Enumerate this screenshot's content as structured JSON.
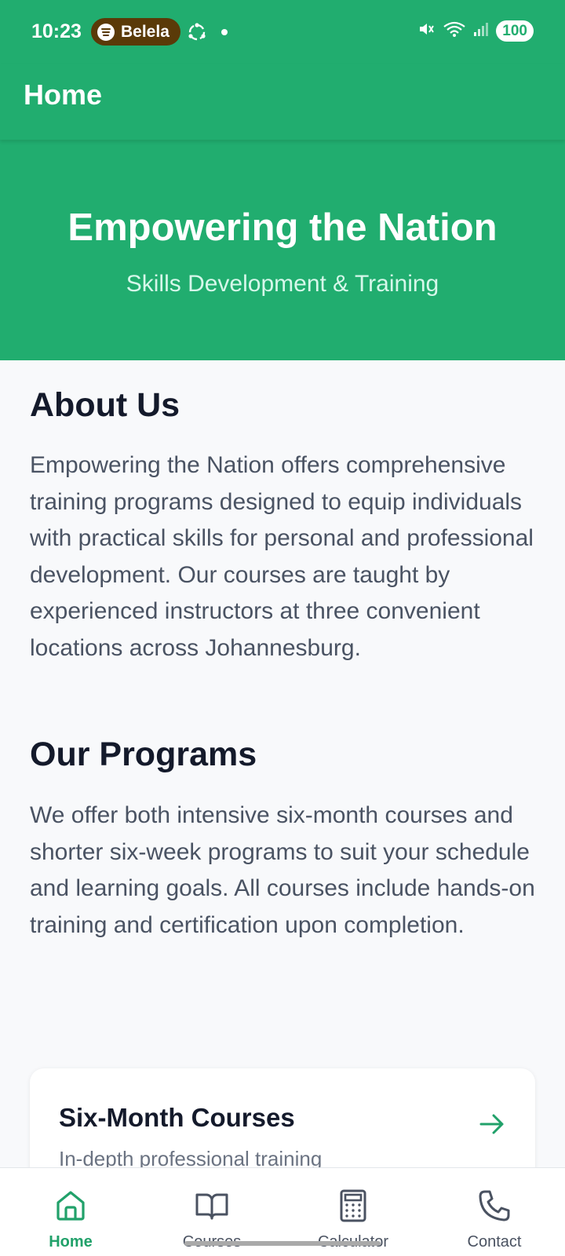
{
  "status_bar": {
    "time": "10:23",
    "spotify_label": "Belela",
    "battery": "100",
    "icons": [
      "spotify-icon",
      "sync-icon",
      "notification-dot-icon",
      "mute-icon",
      "wifi-icon",
      "signal-icon",
      "battery-icon"
    ]
  },
  "app_bar": {
    "title": "Home"
  },
  "hero": {
    "title": "Empowering the Nation",
    "subtitle": "Skills Development & Training"
  },
  "about": {
    "title": "About Us",
    "body": "Empowering the Nation offers comprehensive training programs designed to equip individuals with practical skills for personal and professional development. Our courses are taught by experienced instructors at three convenient locations across Johannesburg."
  },
  "programs": {
    "title": "Our Programs",
    "body": "We offer both intensive six-month courses and shorter six-week programs to suit your schedule and learning goals. All courses include hands-on training and certification upon completion."
  },
  "card": {
    "title": "Six-Month Courses",
    "subtitle": "In-depth professional training",
    "icon": "arrow-right-icon"
  },
  "bottom_nav": {
    "items": [
      {
        "label": "Home",
        "icon": "home-icon",
        "active": true
      },
      {
        "label": "Courses",
        "icon": "book-icon",
        "active": false
      },
      {
        "label": "Calculator",
        "icon": "calculator-icon",
        "active": false
      },
      {
        "label": "Contact",
        "icon": "phone-icon",
        "active": false
      }
    ]
  },
  "colors": {
    "primary": "#21ad6f",
    "subtitle": "#d6f7ea",
    "heading": "#141a2b",
    "body_text": "#4a5363",
    "nav_active": "#21a16a",
    "nav_inactive": "#4a5261"
  }
}
